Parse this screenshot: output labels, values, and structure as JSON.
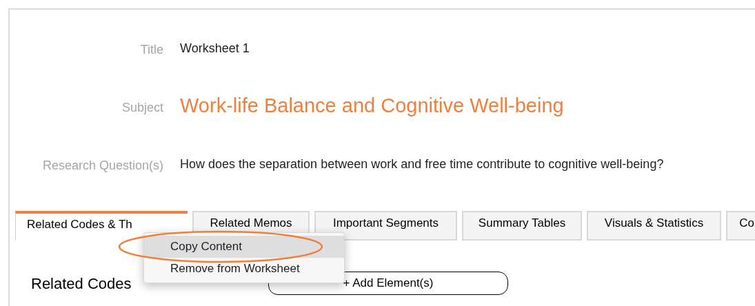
{
  "fields": [
    {
      "label": "Title",
      "value": "Worksheet 1",
      "kind": "plain"
    },
    {
      "label": "Subject",
      "value": "Work-life Balance and Cognitive Well-being",
      "kind": "highlight"
    },
    {
      "label": "Research Question(s)",
      "value": "How does the separation between work and free time contribute to cognitive well-being?",
      "kind": "plain"
    }
  ],
  "tabs": [
    {
      "label": "Related Codes & Th",
      "selected": true
    },
    {
      "label": "Related Memos",
      "selected": false
    },
    {
      "label": "Important Segments",
      "selected": false
    },
    {
      "label": "Summary Tables",
      "selected": false
    },
    {
      "label": "Visuals & Statistics",
      "selected": false
    },
    {
      "label": "Co",
      "selected": false
    }
  ],
  "section": {
    "heading": "Related Codes",
    "button": "+ Add Element(s)"
  },
  "context_menu": {
    "items": [
      {
        "label": "Copy Content",
        "selected": true
      },
      {
        "label": "Remove from Worksheet",
        "selected": false
      }
    ]
  },
  "annotation": {
    "kind": "ellipse",
    "color": "#f07f3c"
  }
}
